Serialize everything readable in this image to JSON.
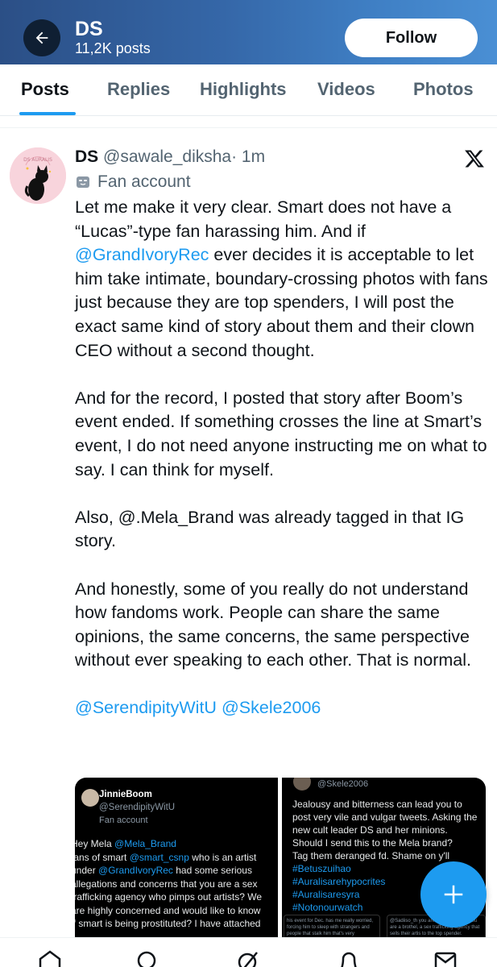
{
  "header": {
    "name": "DS",
    "posts_count": "11,2K posts",
    "follow_label": "Follow",
    "banner_color": "#3567a8"
  },
  "tabs": [
    {
      "label": "Posts",
      "active": true
    },
    {
      "label": "Replies",
      "active": false
    },
    {
      "label": "Highlights",
      "active": false
    },
    {
      "label": "Videos",
      "active": false
    },
    {
      "label": "Photos",
      "active": false
    }
  ],
  "post": {
    "author_name": "DS",
    "author_handle": "@sawale_diksha",
    "time": "· 1m",
    "label": "Fan account",
    "avatar_text": "DS AURALIS",
    "paragraphs": {
      "p1_a": "Let me make it very clear. Smart does not have a “Lucas”-type fan harassing him. And if ",
      "p1_mention": "@GrandIvoryRec",
      "p1_b": " ever decides it is acceptable to let him take intimate, boundary-crossing photos with fans just because they are top spenders, I will post the exact same kind of story about them and their clown CEO without a second thought.",
      "p2": "And for the record, I posted that story after Boom’s event ended. If something crosses the line at Smart’s event, I do not need anyone instructing me on what to say. I can think for myself.",
      "p3": "Also, @.Mela_Brand was already tagged in that IG story.",
      "p4": "And honestly, some of you really do not understand how fandoms work. People can share the same opinions, the same concerns, the same perspective without ever speaking to each other. That is normal.",
      "mention_1": "@SerendipityWitU",
      "mention_2": "@Skele2006"
    }
  },
  "media_left": {
    "name": "JinnieBoom",
    "handle": "@SerendipityWitU",
    "label": "Fan account",
    "line1_a": "Hey Mela ",
    "line1_mention": "@Mela_Brand",
    "line2_a": "fans of smart ",
    "line2_mention": "@smart_csnp",
    "line2_b": " who is an artist",
    "line3_a": "under ",
    "line3_mention": "@GrandIvoryRec",
    "line3_b": " had some serious",
    "line4": "allegations and concerns that you are a sex",
    "line5": "trafficking agency who pimps out artists? We",
    "line6": "are highly concerned and would like to know",
    "line7": "if smart is being prostituted? I have attached"
  },
  "media_right": {
    "handle": "@Skele2006",
    "text": "Jealousy and bitterness can lead you to post very vile and vulgar tweets. Asking the new cult leader DS and her minions. Should I send this to the Mela brand?",
    "line2": "Tag them deranged fd. Shame on y'll",
    "tags": [
      "#Betuszuihao",
      "#Auralisarehypocrites",
      "#Auralisaresyra",
      "#Notonourwatch"
    ],
    "thumb1": "his event for Dec. has me really worried, forcing him to sleep with strangers and people that stalk him that's very concerning and disturbing, that's not work it's exploitation.",
    "thumb2": "@Sadiiso_th you are not a company you are a brothel, a sex trafficking agency that sells their artis to the top spender."
  },
  "accent_color": "#1d9bf0"
}
